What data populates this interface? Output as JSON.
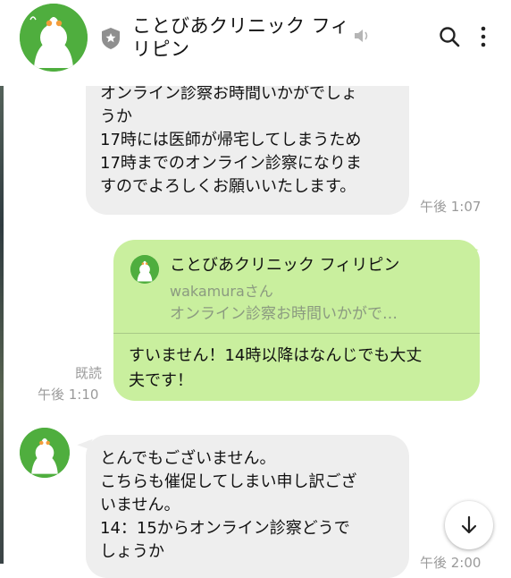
{
  "header": {
    "title": "ことびあクリニック フィリピン"
  },
  "messages": [
    {
      "direction": "incoming",
      "text": "オンライン診察お時間いかがでしょ\nうか\n17時には医師が帰宅してしまうため\n17時までのオンライン診察になりま\nすのでよろしくお願いいたします。",
      "time": "午後 1:07"
    },
    {
      "direction": "outgoing",
      "quote": {
        "name": "ことびあクリニック フィリピン",
        "subtitle": "wakamuraさん",
        "snippet": "オンライン診察お時間いかがで…"
      },
      "text": "すいません！14時以降はなんじでも大丈\n夫です！",
      "read_label": "既読",
      "time": "午後 1:10"
    },
    {
      "direction": "incoming",
      "text": "とんでもございません。\nこちらも催促してしまい申し訳ござ\nいません。\n14：15からオンライン診察どうで\nしょうか",
      "time": "午後 2:00"
    }
  ],
  "colors": {
    "brand_green": "#4fae3e",
    "outgoing_bubble": "#c9ef9e",
    "incoming_bubble": "#eeeeee",
    "meta_gray": "#9a9a9a"
  },
  "icons": [
    "official-badge-icon",
    "mute-icon",
    "search-icon",
    "more-vert-icon",
    "arrow-down-icon"
  ]
}
